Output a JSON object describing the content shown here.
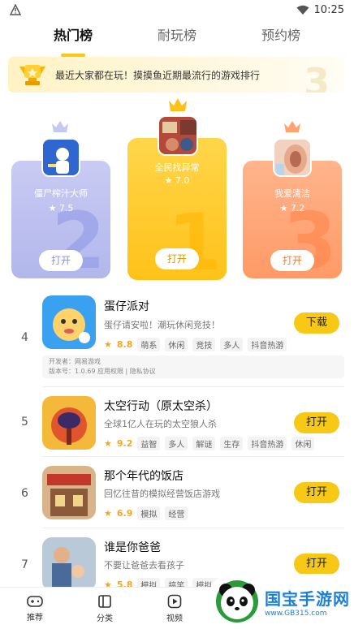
{
  "status_bar": {
    "time": "10:25"
  },
  "tabs": [
    {
      "label": "热门榜",
      "active": true
    },
    {
      "label": "耐玩榜",
      "active": false
    },
    {
      "label": "预约榜",
      "active": false
    }
  ],
  "banner": {
    "text": "最近大家都在玩！摸摸鱼近期最流行的游戏排行"
  },
  "podium": [
    {
      "rank": "2",
      "name": "僵尸榨汁大师",
      "score": "7.5",
      "button": "打开"
    },
    {
      "rank": "1",
      "name": "全民找异常",
      "score": "7.0",
      "button": "打开"
    },
    {
      "rank": "3",
      "name": "我爱清洁",
      "score": "7.2",
      "button": "打开"
    }
  ],
  "list": [
    {
      "rank": "4",
      "name": "蛋仔派对",
      "desc": "蛋仔请安啦！潮玩休闲竞技！",
      "rating": "8.8",
      "tags": [
        "萌系",
        "休闲",
        "竞技",
        "多人",
        "抖音热游"
      ],
      "button": "下载",
      "info_line1": "开发者：网易游戏",
      "info_line2": "版本号：1.0.69  应用权限 | 隐私协议"
    },
    {
      "rank": "5",
      "name": "太空行动（原太空杀）",
      "desc": "全球1亿人在玩的太空狼人杀",
      "rating": "9.2",
      "tags": [
        "益智",
        "多人",
        "解谜",
        "生存",
        "抖音热游",
        "休闲"
      ],
      "button": "打开"
    },
    {
      "rank": "6",
      "name": "那个年代的饭店",
      "desc": "回忆往昔的模拟经营饭店游戏",
      "rating": "6.9",
      "tags": [
        "模拟",
        "经营"
      ],
      "button": "打开"
    },
    {
      "rank": "7",
      "name": "谁是你爸爸",
      "desc": "不要让爸爸去看孩子",
      "rating": "5.8",
      "tags": [
        "模拟",
        "搞笑",
        "模拟人"
      ],
      "button": "打开"
    }
  ],
  "nav": [
    {
      "label": "推荐",
      "icon": "gamepad-icon"
    },
    {
      "label": "分类",
      "icon": "category-icon"
    },
    {
      "label": "视频",
      "icon": "play-icon"
    }
  ],
  "watermark": {
    "title": "国宝手游网",
    "url": "www.GB315.com"
  },
  "colors": {
    "accent": "#f7c815",
    "silver": "#b2b7ec",
    "gold": "#ffc21a",
    "bronze": "#ff9a66"
  }
}
